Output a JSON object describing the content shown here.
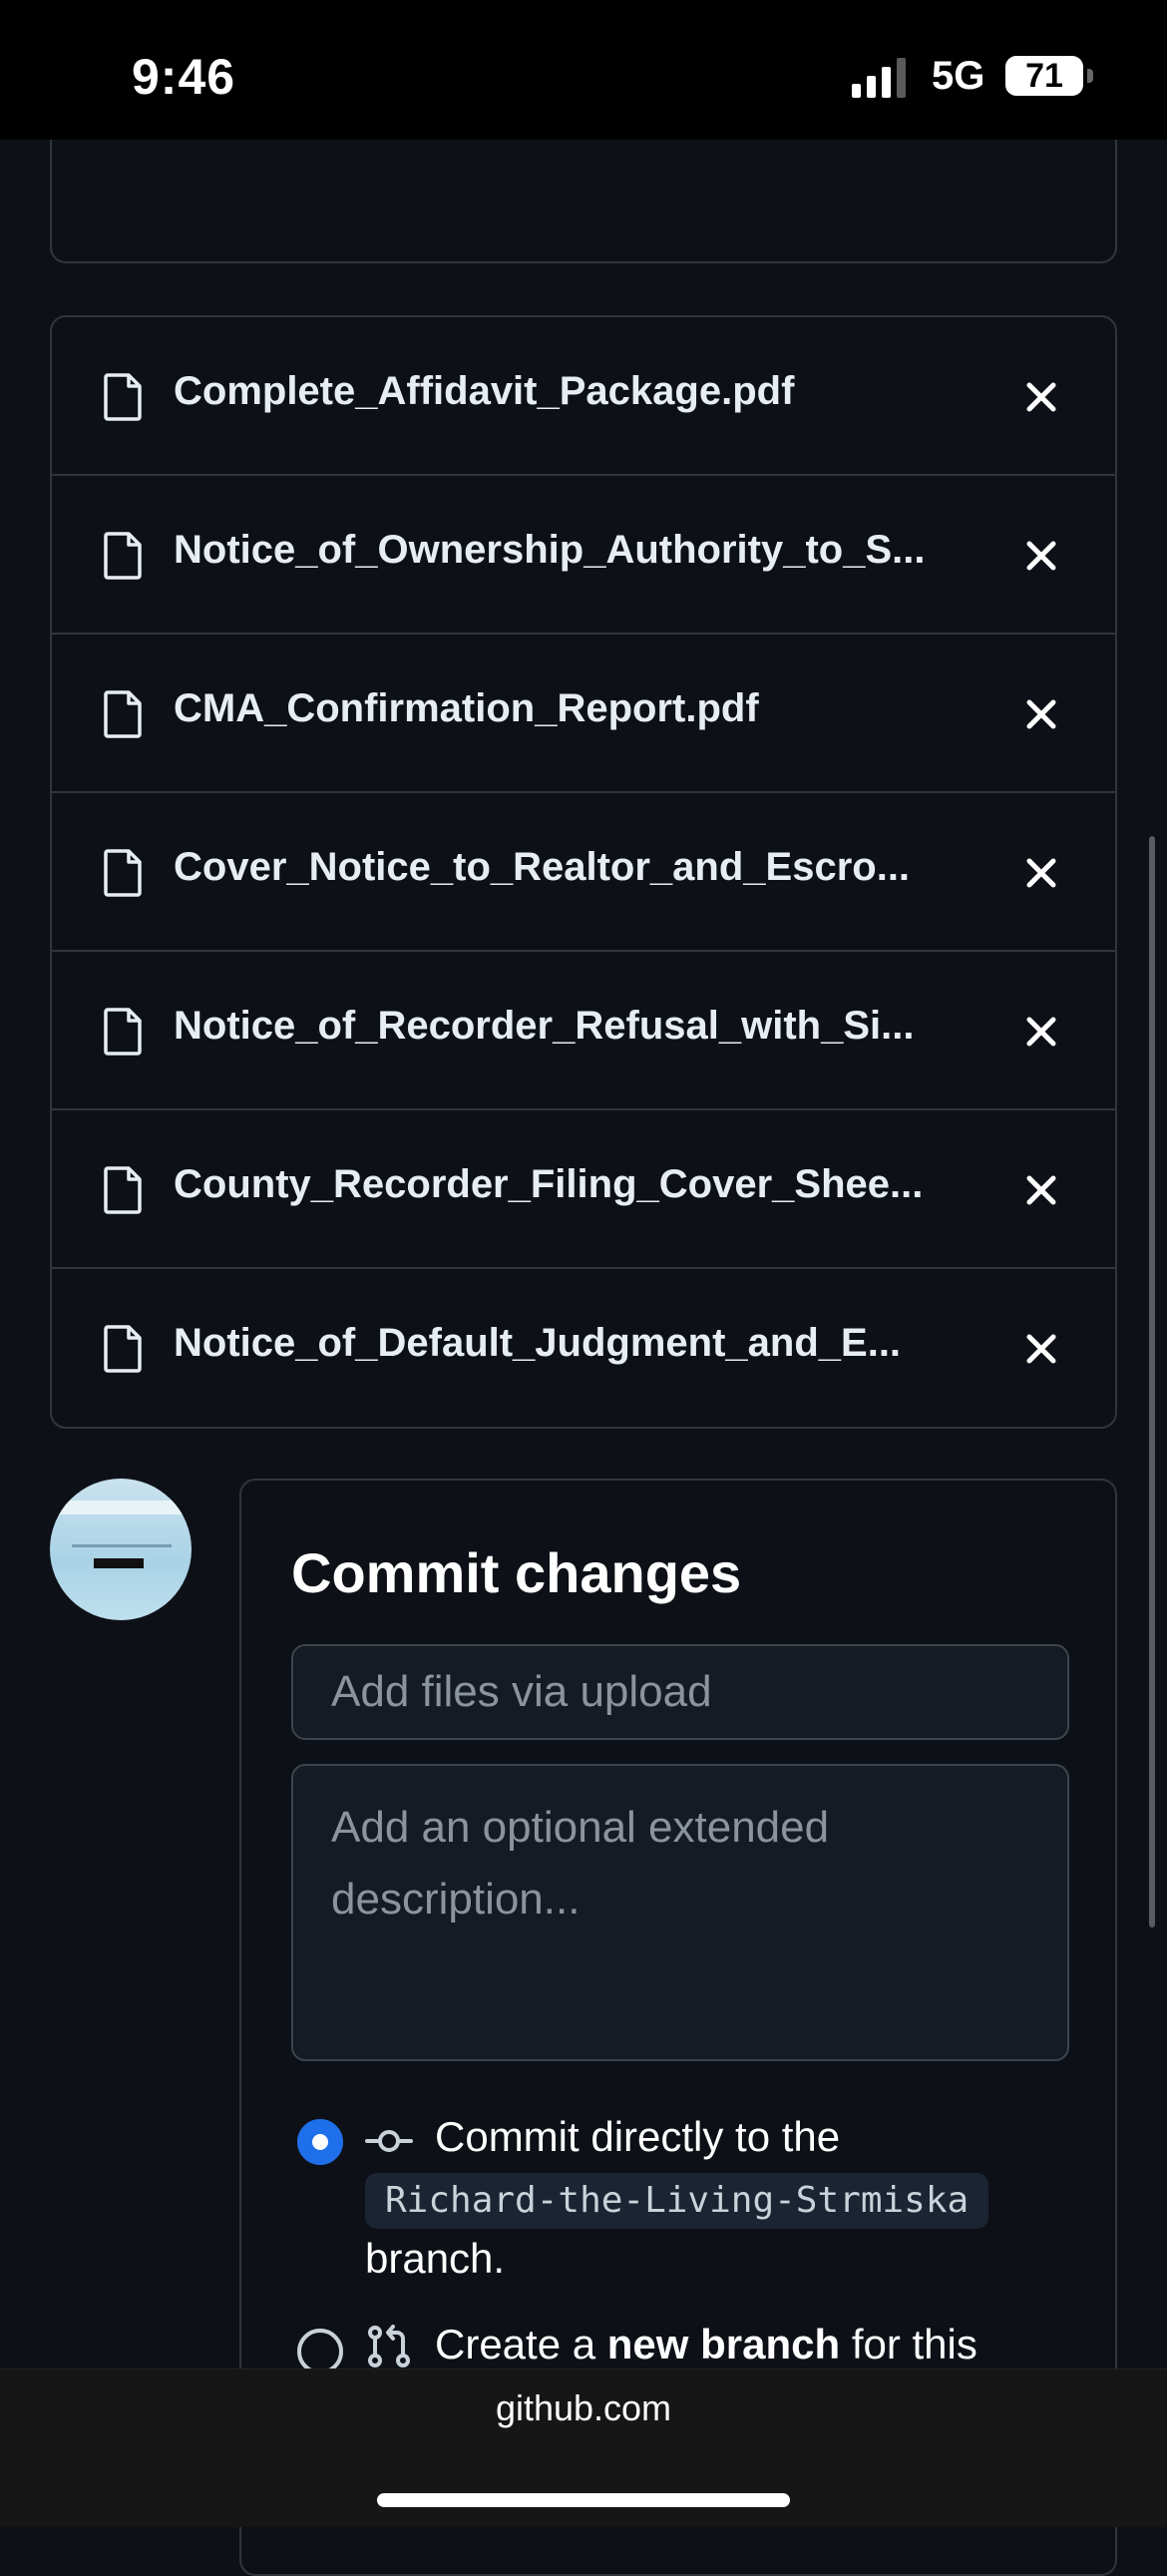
{
  "status_bar": {
    "time": "9:46",
    "network": "5G",
    "battery": "71"
  },
  "files": [
    {
      "name": "Complete_Affidavit_Package.pdf"
    },
    {
      "name": "Notice_of_Ownership_Authority_to_S..."
    },
    {
      "name": "CMA_Confirmation_Report.pdf"
    },
    {
      "name": "Cover_Notice_to_Realtor_and_Escro..."
    },
    {
      "name": "Notice_of_Recorder_Refusal_with_Si..."
    },
    {
      "name": "County_Recorder_Filing_Cover_Shee..."
    },
    {
      "name": "Notice_of_Default_Judgment_and_E..."
    }
  ],
  "commit": {
    "title": "Commit changes",
    "summary_placeholder": "Add files via upload",
    "description_placeholder": "Add an optional extended description...",
    "option_direct": {
      "text": "Commit directly to the",
      "branch": "Richard-the-Living-Strmiska",
      "suffix": "branch.",
      "selected": true
    },
    "option_new": {
      "prefix": "Create a ",
      "bold": "new branch",
      "suffix": " for this",
      "selected": false
    }
  },
  "browser": {
    "domain": "github.com"
  }
}
